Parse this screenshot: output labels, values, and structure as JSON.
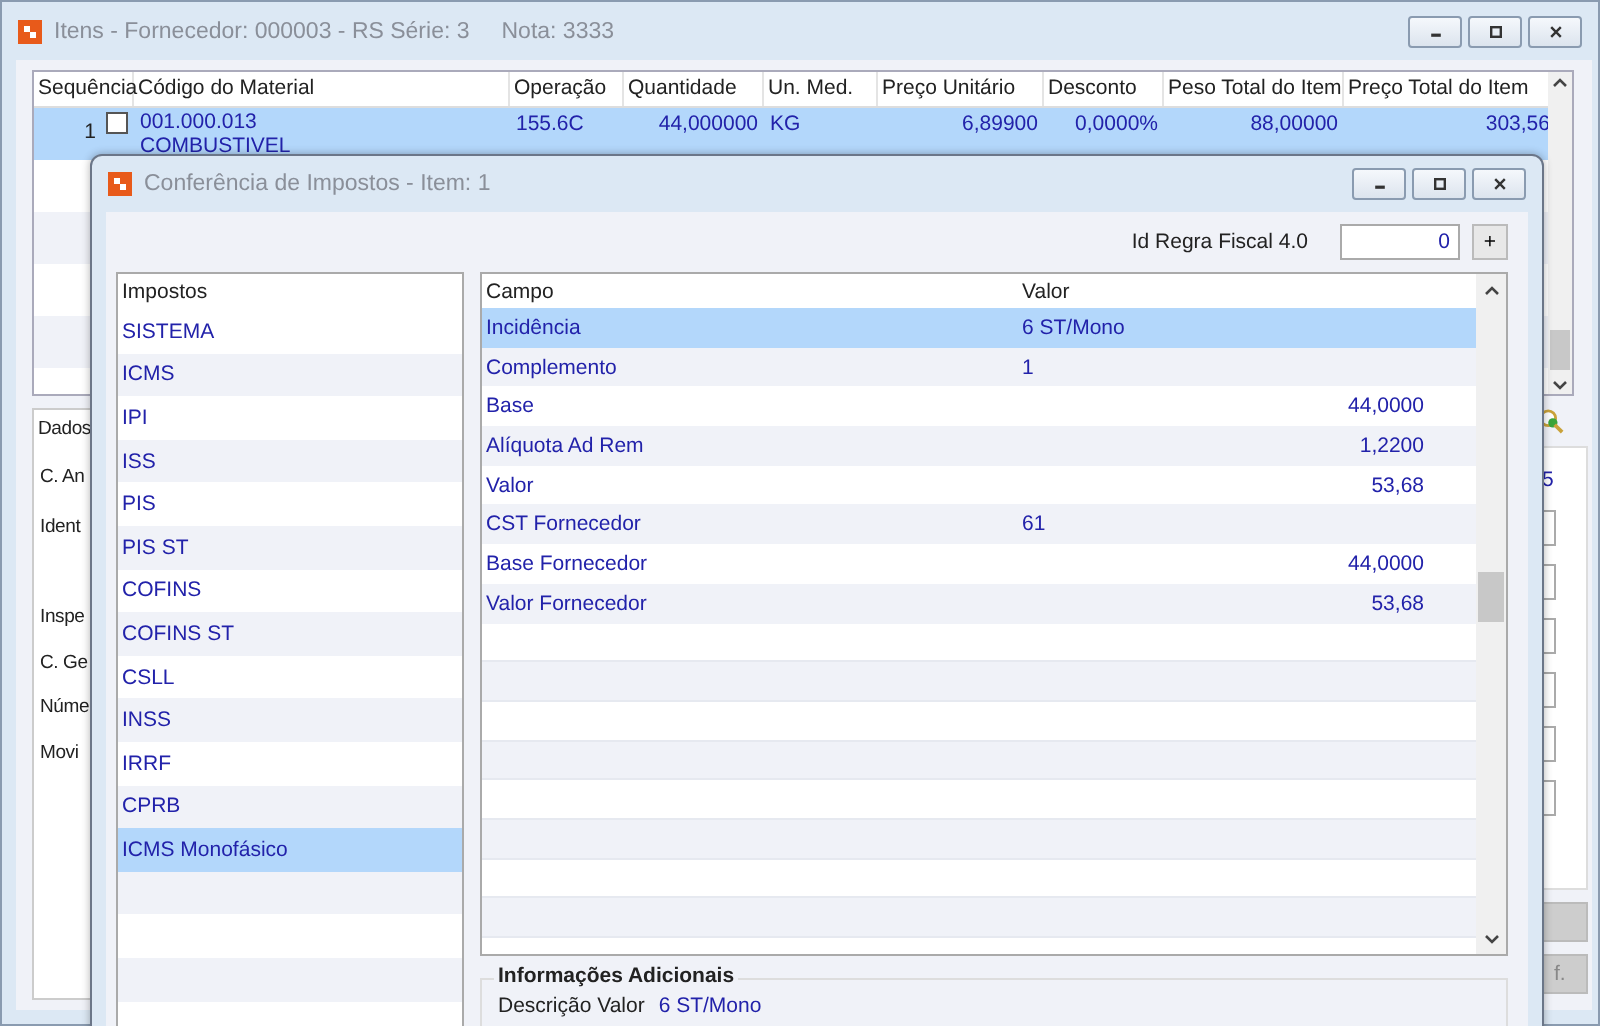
{
  "main_window": {
    "title": "Itens - Fornecedor: 000003 - RS Série: 3",
    "note": "Nota: 3333",
    "columns": [
      "Sequência",
      "Código do Material",
      "Operação",
      "Quantidade",
      "Un. Med.",
      "Preço Unitário",
      "Desconto",
      "Peso Total do Item",
      "Preço Total do Item"
    ],
    "rows": [
      {
        "sequencia": "1",
        "checked": false,
        "codigo": "001.000.013",
        "descricao": "COMBUSTIVEL",
        "operacao": "155.6C",
        "quantidade": "44,000000",
        "un_med": "KG",
        "preco_unitario": "6,89900",
        "desconto": "0,0000%",
        "peso_total": "88,00000",
        "preco_total": "303,56",
        "selected": true
      }
    ],
    "details_tab": "Dados",
    "detail_labels": [
      "C. An",
      "Ident",
      "Inspe",
      "C. Ge",
      "Núme",
      "Movi"
    ],
    "right_text": "5",
    "right_button": "f."
  },
  "dialog": {
    "title": "Conferência de Impostos - Item: 1",
    "id_regra_label": "Id Regra Fiscal 4.0",
    "id_regra_value": "0",
    "add_button": "+",
    "taxes_header": "Impostos",
    "taxes": [
      {
        "label": "SISTEMA",
        "selected": false
      },
      {
        "label": "ICMS",
        "selected": false
      },
      {
        "label": "IPI",
        "selected": false
      },
      {
        "label": "ISS",
        "selected": false
      },
      {
        "label": "PIS",
        "selected": false
      },
      {
        "label": "PIS ST",
        "selected": false
      },
      {
        "label": "COFINS",
        "selected": false
      },
      {
        "label": "COFINS ST",
        "selected": false
      },
      {
        "label": "CSLL",
        "selected": false
      },
      {
        "label": "INSS",
        "selected": false
      },
      {
        "label": "IRRF",
        "selected": false
      },
      {
        "label": "CPRB",
        "selected": false
      },
      {
        "label": "ICMS Monofásico",
        "selected": true
      }
    ],
    "fields_columns": [
      "Campo",
      "Valor"
    ],
    "fields": [
      {
        "campo": "Incidência",
        "valor": "6 ST/Mono",
        "kind": "code",
        "selected": true
      },
      {
        "campo": "Complemento",
        "valor": "1",
        "kind": "code",
        "selected": false
      },
      {
        "campo": "Base",
        "valor": "44,0000",
        "kind": "number",
        "selected": false
      },
      {
        "campo": "Alíquota Ad Rem",
        "valor": "1,2200",
        "kind": "number",
        "selected": false
      },
      {
        "campo": "Valor",
        "valor": "53,68",
        "kind": "number",
        "selected": false
      },
      {
        "campo": "CST Fornecedor",
        "valor": "61",
        "kind": "code",
        "selected": false
      },
      {
        "campo": "Base Fornecedor",
        "valor": "44,0000",
        "kind": "number",
        "selected": false
      },
      {
        "campo": "Valor Fornecedor",
        "valor": "53,68",
        "kind": "number",
        "selected": false
      }
    ],
    "info_title": "Informações Adicionais",
    "info_label": "Descrição Valor",
    "info_value": "6 ST/Mono"
  }
}
